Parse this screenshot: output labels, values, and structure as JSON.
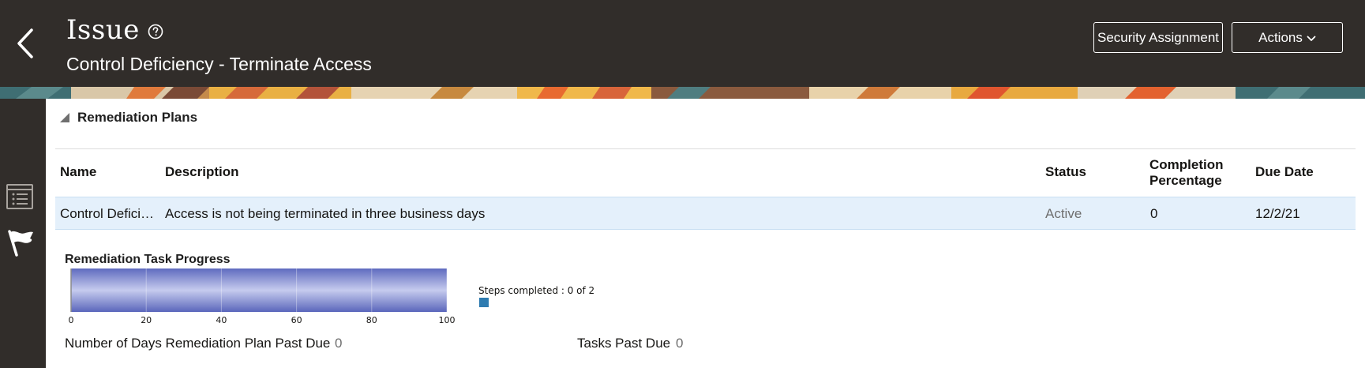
{
  "header": {
    "title": "Issue",
    "subtitle": "Control Deficiency - Terminate Access",
    "security_button": "Security Assignment",
    "actions_button": "Actions",
    "back_icon": "chevron-left-icon",
    "help_icon": "question-circle-icon",
    "background": "#312d2a"
  },
  "rail": {
    "icons": [
      "list-icon",
      "flag-icon"
    ]
  },
  "section": {
    "title": "Remediation Plans",
    "table": {
      "columns": {
        "name": "Name",
        "description": "Description",
        "status": "Status",
        "completion_line1": "Completion",
        "completion_line2": "Percentage",
        "due_date": "Due Date"
      },
      "rows": [
        {
          "name": "Control Defici…",
          "description": "Access is not being terminated in three business days",
          "status": "Active",
          "completion": "0",
          "due_date": "12/2/21"
        }
      ],
      "selected_row_color": "#e4f0fb"
    }
  },
  "progress": {
    "title": "Remediation Task Progress",
    "legend_label": "Steps completed : 0 of 2",
    "legend_color": "#2e7bb0"
  },
  "chart_data": {
    "type": "bar",
    "orientation": "horizontal",
    "series": [
      {
        "values": [
          0
        ]
      }
    ],
    "xticks": [
      "0",
      "20",
      "40",
      "60",
      "80",
      "100"
    ],
    "xlim": [
      0,
      100
    ],
    "grid": true,
    "legend": "right"
  },
  "metrics": {
    "days_past_due_label": "Number of Days Remediation Plan Past Due",
    "days_past_due_value": "0",
    "tasks_past_due_label": "Tasks Past Due",
    "tasks_past_due_value": "0"
  }
}
